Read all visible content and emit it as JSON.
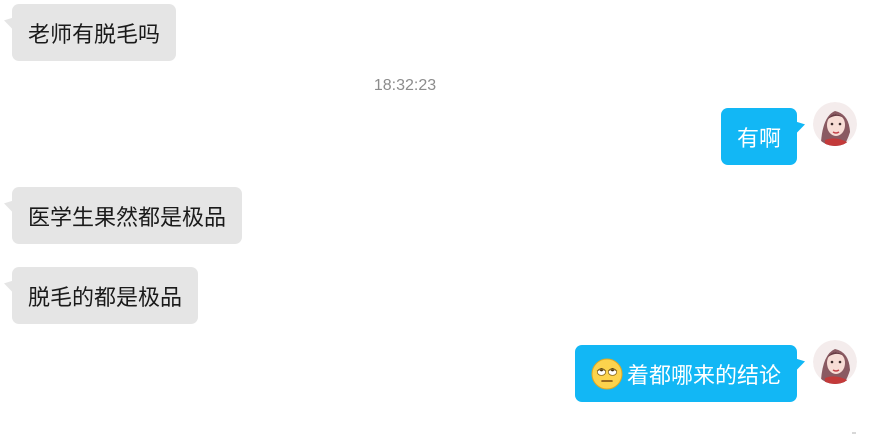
{
  "messages": [
    {
      "side": "left",
      "text": "老师有脱毛吗"
    },
    {
      "side": "right",
      "text": "有啊"
    },
    {
      "side": "left",
      "text": "医学生果然都是极品"
    },
    {
      "side": "left",
      "text": "脱毛的都是极品"
    },
    {
      "side": "right",
      "text": "着都哪来的结论",
      "emoji": "eye-roll-emoji-icon"
    }
  ],
  "timestamp": "18:32:23",
  "colors": {
    "incoming_bubble": "#e5e5e5",
    "outgoing_bubble": "#12b7f5",
    "timestamp_text": "#8c8c8c"
  }
}
